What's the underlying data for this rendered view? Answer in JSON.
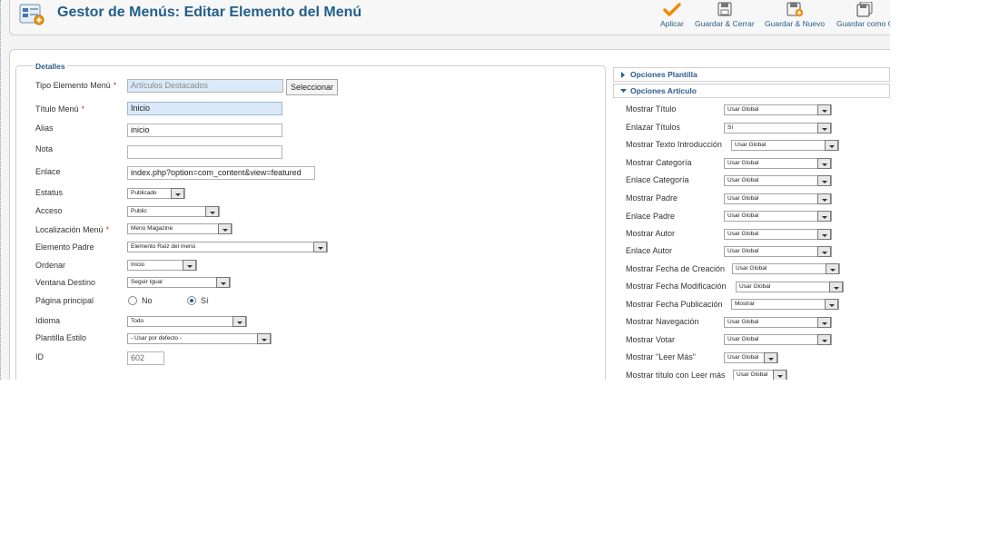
{
  "header": {
    "title": "Gestor de Menús: Editar Elemento del Menú",
    "toolbar": [
      {
        "label": "Aplicar",
        "icon": "apply-check-icon"
      },
      {
        "label": "Guardar & Cerrar",
        "icon": "save-close-icon"
      },
      {
        "label": "Guardar & Nuevo",
        "icon": "save-new-icon"
      },
      {
        "label": "Guardar como C",
        "icon": "save-copy-icon"
      }
    ]
  },
  "details": {
    "legend": "Detalles",
    "tipo": {
      "label": "Tipo Elemento Menú",
      "value": "Artículos Destacados",
      "button": "Seleccionar"
    },
    "titulo": {
      "label": "Título Menú",
      "value": "Inicio"
    },
    "alias": {
      "label": "Alias",
      "value": "inicio"
    },
    "nota": {
      "label": "Nota",
      "value": ""
    },
    "enlace": {
      "label": "Enlace",
      "value": "index.php?option=com_content&view=featured"
    },
    "estatus": {
      "label": "Estatus",
      "value": "Publicado"
    },
    "acceso": {
      "label": "Acceso",
      "value": "Public"
    },
    "localizacion": {
      "label": "Localización Menú",
      "value": "Menú Magazine"
    },
    "padre": {
      "label": "Elemento Padre",
      "value": "Elemento Raíz del menú"
    },
    "ordenar": {
      "label": "Ordenar",
      "value": "Inicio"
    },
    "ventana": {
      "label": "Ventana Destino",
      "value": "Seguir Igual"
    },
    "principal": {
      "label": "Página principal",
      "no": "No",
      "si": "Sí",
      "selected": "Sí"
    },
    "idioma": {
      "label": "Idioma",
      "value": "Todo"
    },
    "plantilla": {
      "label": "Plantilla Estilo",
      "value": "- Usar por defecto -"
    },
    "id": {
      "label": "ID",
      "value": "602"
    }
  },
  "right": {
    "pane1": "Opciones Plantilla",
    "pane2": "Opciones Artículo",
    "rows": [
      {
        "label": "Mostrar Título",
        "value": "Usar Global"
      },
      {
        "label": "Enlazar Títulos",
        "value": "Sí"
      },
      {
        "label": "Mostrar Texto Introducción",
        "value": "Usar Global"
      },
      {
        "label": "Mostrar Categoría",
        "value": "Usar Global"
      },
      {
        "label": "Enlace Categoría",
        "value": "Usar Global"
      },
      {
        "label": "Mostrar Padre",
        "value": "Usar Global"
      },
      {
        "label": "Enlace Padre",
        "value": "Usar Global"
      },
      {
        "label": "Mostrar Autor",
        "value": "Usar Global"
      },
      {
        "label": "Enlace Autor",
        "value": "Usar Global"
      },
      {
        "label": "Mostrar Fecha de Creación",
        "value": "Usar Global"
      },
      {
        "label": "Mostrar Fecha Modificación",
        "value": "Usar Global"
      },
      {
        "label": "Mostrar Fecha Publicación",
        "value": "Mostrar"
      },
      {
        "label": "Mostrar Navegación",
        "value": "Usar Global"
      },
      {
        "label": "Mostrar Votar",
        "value": "Usar Global"
      },
      {
        "label": "Mostrar \"Leer Más\"",
        "value": "Usar Global"
      },
      {
        "label": "Mostrar título con Leer más",
        "value": "Usar Global"
      }
    ]
  }
}
